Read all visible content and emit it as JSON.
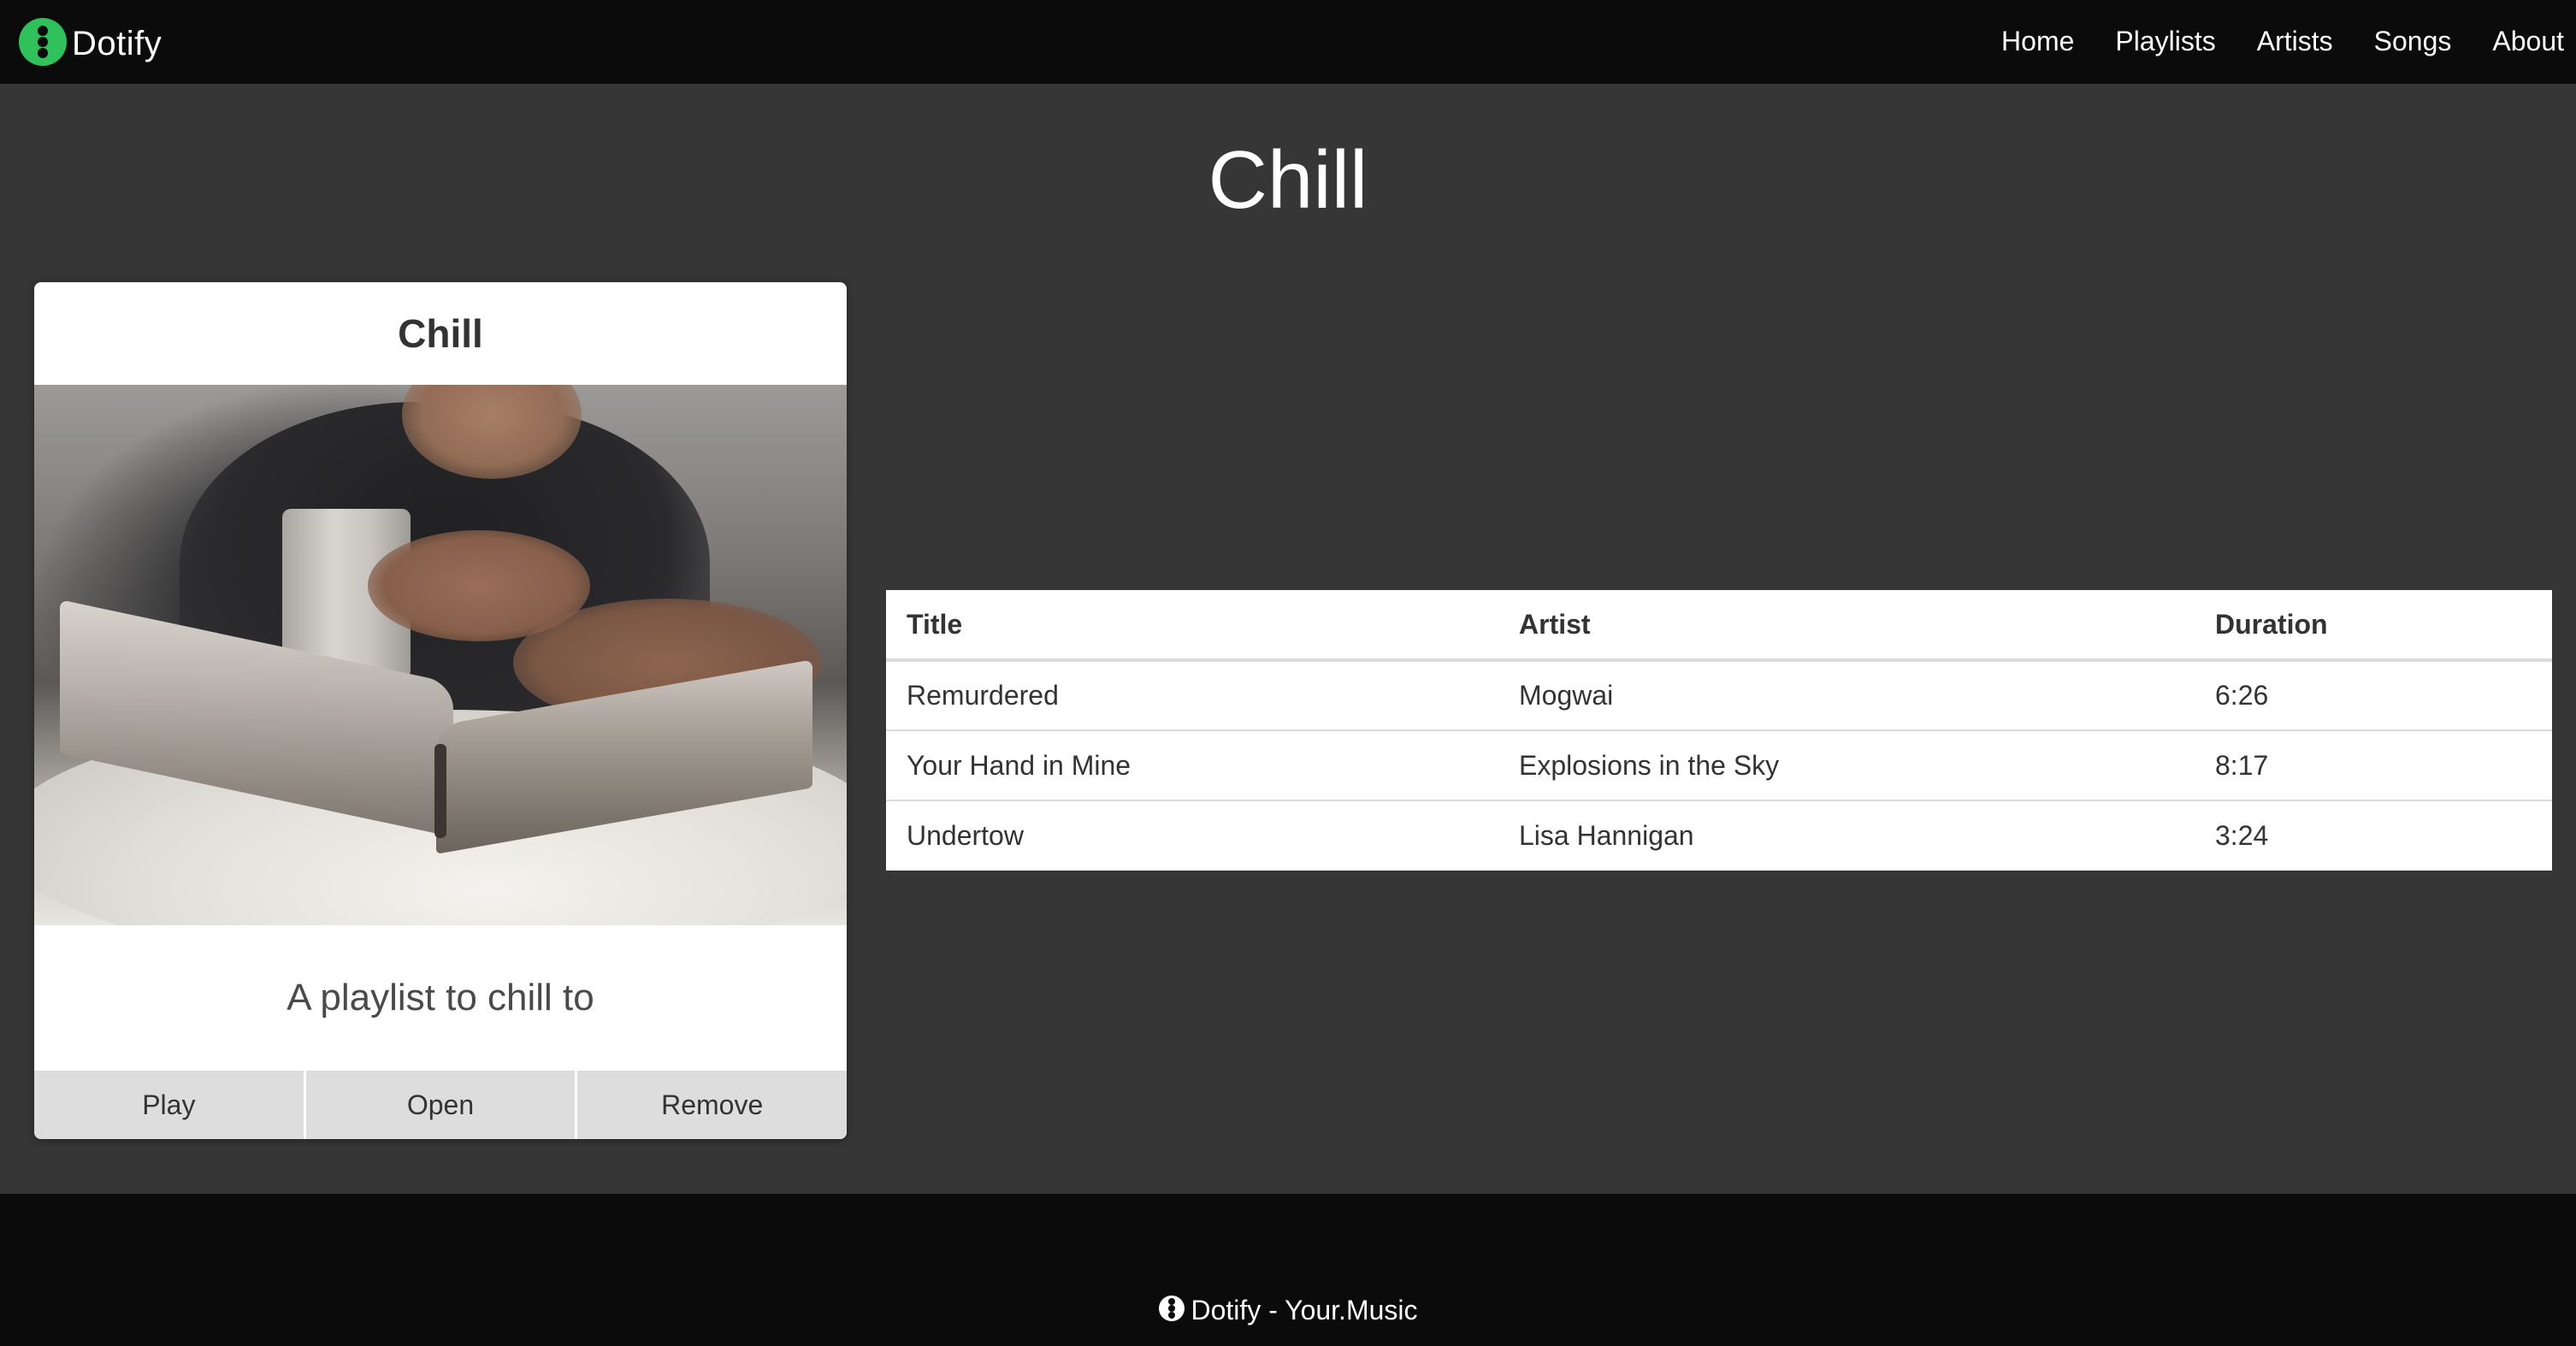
{
  "brand": {
    "name": "Dotify",
    "logo_icon": "dotify-logo-icon",
    "logo_color": "#2fc15a"
  },
  "nav": {
    "links": [
      {
        "label": "Home"
      },
      {
        "label": "Playlists"
      },
      {
        "label": "Artists"
      },
      {
        "label": "Songs"
      },
      {
        "label": "About"
      }
    ]
  },
  "page": {
    "title": "Chill"
  },
  "card": {
    "title": "Chill",
    "image_icon": "playlist-cover-image",
    "description": "A playlist to chill to",
    "actions": [
      {
        "label": "Play"
      },
      {
        "label": "Open"
      },
      {
        "label": "Remove"
      }
    ]
  },
  "table": {
    "headers": [
      "Title",
      "Artist",
      "Duration"
    ],
    "rows": [
      {
        "title": "Remurdered",
        "artist": "Mogwai",
        "duration": "6:26"
      },
      {
        "title": "Your Hand in Mine",
        "artist": "Explosions in the Sky",
        "duration": "8:17"
      },
      {
        "title": "Undertow",
        "artist": "Lisa Hannigan",
        "duration": "3:24"
      }
    ]
  },
  "footer": {
    "text": "Dotify - Your.Music",
    "logo_icon": "dotify-logo-icon"
  },
  "colors": {
    "background": "#363636",
    "navbar": "#0b0b0b",
    "card": "#ffffff",
    "button": "#dddddd"
  }
}
